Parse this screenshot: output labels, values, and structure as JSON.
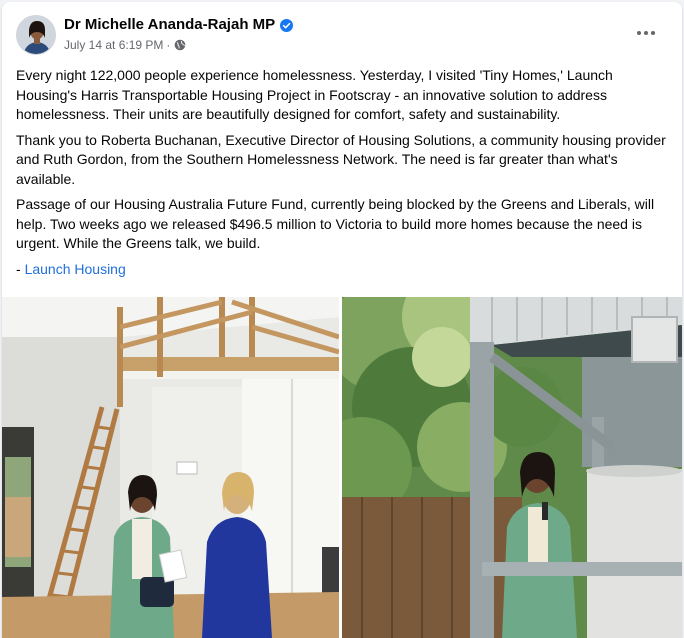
{
  "post": {
    "author": "Dr Michelle Ananda-Rajah MP",
    "timestamp": "July 14 at 6:19 PM",
    "separator": "·",
    "paragraphs": [
      "Every night 122,000 people experience homelessness. Yesterday, I visited 'Tiny Homes,' Launch Housing's Harris Transportable Housing Project in Footscray - an innovative solution to address homelessness. Their units are beautifully designed for comfort, safety and sustainability.",
      "Thank you to Roberta Buchanan, Executive Director of Housing Solutions, a community housing provider and Ruth Gordon, from the Southern Homelessness Network. The need is far greater than what's available.",
      "Passage of our Housing Australia Future Fund, currently being blocked by the Greens and Liberals, will help. Two weeks ago we released $496.5 million to Victoria to build more homes because the need is urgent. While the Greens talk, we build."
    ],
    "tag_prefix": "- ",
    "tag_link": "Launch Housing"
  },
  "icons": {
    "verified": "verified-badge-icon",
    "audience": "globe-icon",
    "more": "more-options-icon"
  },
  "colors": {
    "link": "#216fdb",
    "verified": "#1877f2",
    "secondary_text": "#65676b"
  }
}
